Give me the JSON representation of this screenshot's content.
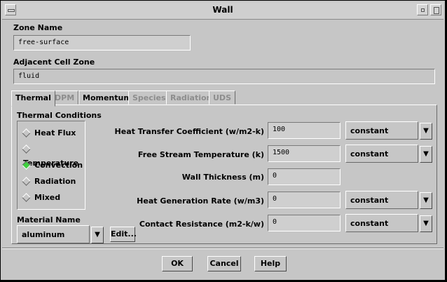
{
  "window": {
    "title": "Wall"
  },
  "zone_name": {
    "label": "Zone Name",
    "value": "free-surface"
  },
  "adjacent_cell_zone": {
    "label": "Adjacent Cell Zone",
    "value": "fluid"
  },
  "tabs": [
    {
      "label": "Thermal",
      "active": true,
      "enabled": true
    },
    {
      "label": "DPM",
      "active": false,
      "enabled": false
    },
    {
      "label": "Momentum",
      "active": false,
      "enabled": true
    },
    {
      "label": "Species",
      "active": false,
      "enabled": false
    },
    {
      "label": "Radiation",
      "active": false,
      "enabled": false
    },
    {
      "label": "UDS",
      "active": false,
      "enabled": false
    }
  ],
  "thermal_conditions": {
    "label": "Thermal Conditions",
    "options": [
      "Heat Flux",
      "Temperature",
      "Convection",
      "Radiation",
      "Mixed"
    ],
    "selected": "Convection"
  },
  "material": {
    "label": "Material Name",
    "value": "aluminum",
    "edit_label": "Edit..."
  },
  "params": {
    "htc": {
      "label": "Heat Transfer Coefficient (w/m2-k)",
      "value": "100",
      "method": "constant"
    },
    "fst": {
      "label": "Free Stream Temperature (k)",
      "value": "1500",
      "method": "constant"
    },
    "wt": {
      "label": "Wall Thickness (m)",
      "value": "0"
    },
    "hgr": {
      "label": "Heat Generation Rate (w/m3)",
      "value": "0",
      "method": "constant"
    },
    "cr": {
      "label": "Contact Resistance (m2-k/w)",
      "value": "0",
      "method": "constant"
    }
  },
  "buttons": {
    "ok": "OK",
    "cancel": "Cancel",
    "help": "Help"
  },
  "icons": {
    "dropdown": "triangle-down-icon",
    "selected_color": "#3fd03f"
  }
}
